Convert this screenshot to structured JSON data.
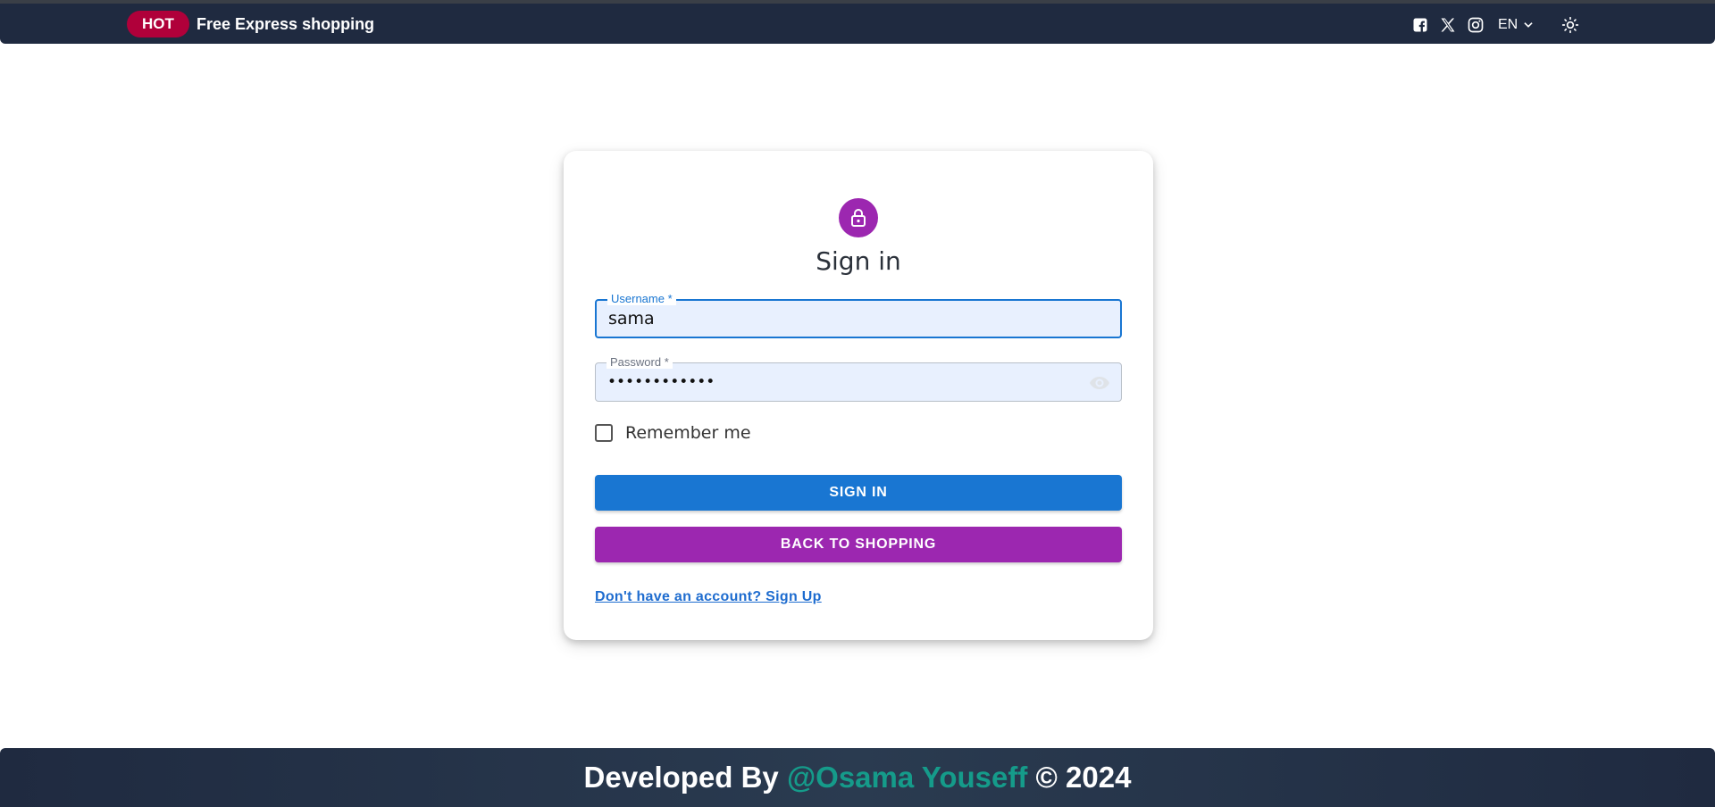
{
  "topbar": {
    "badge": "HOT",
    "promo": "Free Express shopping",
    "language": "EN",
    "icons": [
      "facebook-icon",
      "x-icon",
      "instagram-icon",
      "chevron-down-icon",
      "sun-icon"
    ]
  },
  "login": {
    "title": "Sign in",
    "username_label": "Username *",
    "username_value": "sama",
    "password_label": "Password *",
    "password_value": "••••••••••••",
    "remember_label": "Remember me",
    "remember_checked": false,
    "signin_button": "SIGN IN",
    "back_button": "BACK TO SHOPPING",
    "signup_link": "Don't have an account? Sign Up"
  },
  "footer": {
    "prefix": "Developed By ",
    "author": "@Osama Youseff",
    "suffix": " © 2024"
  },
  "colors": {
    "header_bg": "#1f2a40",
    "hot_badge": "#b0003a",
    "primary": "#1976d2",
    "secondary": "#9c27b0",
    "field_bg": "#e8f0fe",
    "author": "#159b8a"
  }
}
